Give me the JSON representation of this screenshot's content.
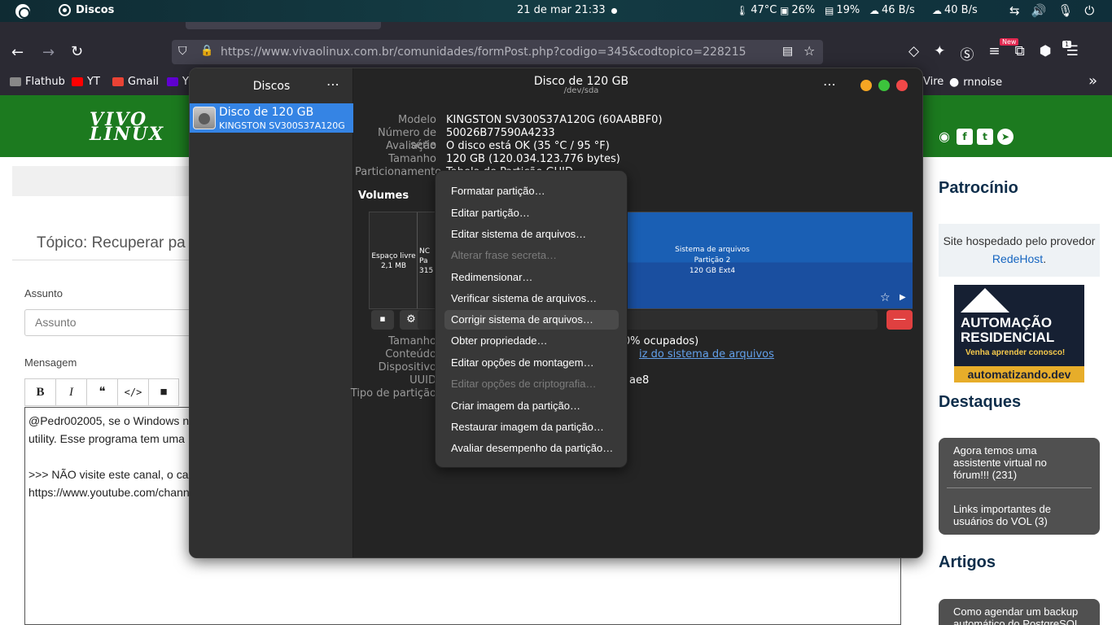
{
  "topbar": {
    "app_name": "Discos",
    "clock": "21 de mar  21:33",
    "temperature": "47°C",
    "cpu": "26%",
    "memory": "19%",
    "download": "46 B/s",
    "upload": "40 B/s"
  },
  "browser": {
    "url": "https://www.vivaolinux.com.br/comunidades/formPost.php?codigo=345&codtopico=228215",
    "url_host": "vivaolinux.com.br",
    "new_badge": "New",
    "ext_badge_count": "1",
    "bookmarks": [
      {
        "label": "Flathub",
        "color": "#888888"
      },
      {
        "label": "YT",
        "color": "#ff0000"
      },
      {
        "label": "Gmail",
        "color": "#ea4335"
      },
      {
        "label": "Y",
        "color": "#6001d2"
      },
      {
        "label": "Vire",
        "color": "#2b2a33"
      },
      {
        "label": "rnnoise",
        "color": "#ffffff"
      }
    ]
  },
  "site": {
    "logo_line1": "VIVO",
    "logo_line2": "LINUX",
    "topic_title": "Tópico: Recuperar pa",
    "label_subject": "Assunto",
    "subject_placeholder": "Assunto",
    "label_message": "Mensagem",
    "editor_buttons": [
      "B",
      "I",
      "❝",
      "</>",
      "■"
    ],
    "editor_lines": [
      "@Pedr002005, se o Windows n",
      "utility. Esse programa tem uma",
      "",
      ">>> NÃO visite este canal, o ca",
      "https://www.youtube.com/chann"
    ],
    "sidebar": {
      "sponsor_heading": "Patrocínio",
      "sponsor_text": "Site hospedado pelo provedor",
      "sponsor_link": "RedeHost",
      "ad_line1": "AUTOMAÇÃO",
      "ad_line2": "RESIDENCIAL",
      "ad_tagline": "Venha aprender conosco!",
      "ad_domain": "automatizando.dev",
      "highlights_heading": "Destaques",
      "highlights": [
        "Agora temos uma assistente virtual no fórum!!! (231)",
        "Links importantes de usuários do VOL (3)"
      ],
      "articles_heading": "Artigos",
      "articles": [
        "Como agendar um backup automático do PostgreSQL"
      ]
    }
  },
  "disks": {
    "sidebar_title": "Discos",
    "disk_name": "Disco de 120 GB",
    "disk_model": "KINGSTON SV300S37A120G",
    "title": "Disco de 120 GB",
    "subtitle": "/dev/sda",
    "info": [
      {
        "key": "Modelo",
        "value": "KINGSTON SV300S37A120G (60AABBF0)"
      },
      {
        "key": "Número de série",
        "value": "50026B77590A4233"
      },
      {
        "key": "Avaliação",
        "value": "O disco está OK (35 °C / 95 °F)"
      },
      {
        "key": "Tamanho",
        "value": "120 GB (120.034.123.776 bytes)"
      },
      {
        "key": "Particionamento",
        "value": "Tabela de Partição GUID"
      }
    ],
    "volumes_label": "Volumes",
    "free_space_label": "Espaço livre",
    "free_space_size": "2,1 MB",
    "partition1_label": "NC",
    "partition1_sub": "Pa",
    "partition1_size": "315",
    "partition2_title": "Sistema de arquivos",
    "partition2_name": "Partição 2",
    "partition2_size": "120 GB Ext4",
    "details": [
      {
        "key": "Tamanho",
        "value": "nes (46,0% ocupados)"
      },
      {
        "key": "Conteúdo",
        "value": "iz do sistema de arquivos"
      },
      {
        "key": "Dispositivo",
        "value": ""
      },
      {
        "key": "UUID",
        "value": "ae8"
      },
      {
        "key": "Tipo de partição",
        "value": ""
      }
    ],
    "remove_label": "—"
  },
  "context_menu": [
    {
      "label": "Formatar partição…",
      "enabled": true
    },
    {
      "label": "Editar partição…",
      "enabled": true
    },
    {
      "label": "Editar sistema de arquivos…",
      "enabled": true
    },
    {
      "label": "Alterar frase secreta…",
      "enabled": false
    },
    {
      "label": "Redimensionar…",
      "enabled": true
    },
    {
      "label": "Verificar sistema de arquivos…",
      "enabled": true
    },
    {
      "label": "Corrigir sistema de arquivos…",
      "enabled": true
    },
    {
      "label": "Obter propriedade…",
      "enabled": true
    },
    {
      "label": "Editar opções de montagem…",
      "enabled": true
    },
    {
      "label": "Editar opções de criptografia…",
      "enabled": false
    },
    {
      "label": "Criar imagem da partição…",
      "enabled": true
    },
    {
      "label": "Restaurar imagem da partição…",
      "enabled": true
    },
    {
      "label": "Avaliar desempenho da partição…",
      "enabled": true
    }
  ],
  "colors": {
    "accent": "#3584e4",
    "site_green": "#1c7a1f",
    "partition_blue": "#1a5fb4"
  }
}
